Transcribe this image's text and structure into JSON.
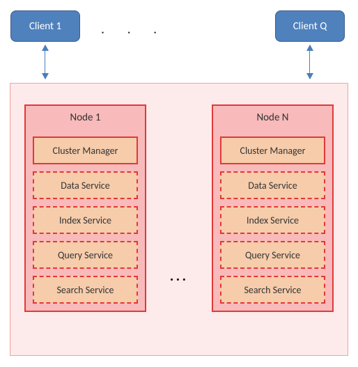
{
  "clients": {
    "left": "Client 1",
    "right": "Client Q",
    "dots": ".   .   ."
  },
  "nodes": {
    "left": {
      "title": "Node 1",
      "services": {
        "cluster_manager": "Cluster Manager",
        "data": "Data Service",
        "index": "Index Service",
        "query": "Query Service",
        "search": "Search Service"
      }
    },
    "right": {
      "title": "Node N",
      "services": {
        "cluster_manager": "Cluster Manager",
        "data": "Data Service",
        "index": "Index Service",
        "query": "Query Service",
        "search": "Search Service"
      }
    },
    "dots": "..."
  }
}
